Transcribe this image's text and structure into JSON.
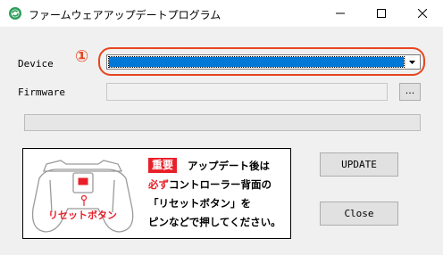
{
  "window": {
    "title": "ファームウェアアップデートプログラム",
    "accent": "#e8451f"
  },
  "form": {
    "device_label": "Device",
    "firmware_label": "Firmware",
    "step_marker": "①",
    "browse_label": "...",
    "device_value": "",
    "firmware_value": ""
  },
  "buttons": {
    "update": "UPDATE",
    "close": "Close"
  },
  "notice": {
    "badge": "重要",
    "line1": "アップデート後は",
    "line2_red": "必ず",
    "line2_rest": "コントローラー背面の",
    "line3": "「リセットボタン」を",
    "line4": "ピンなどで押してください。",
    "reset_label": "リセットボタン"
  },
  "progress": {
    "value": 0
  }
}
